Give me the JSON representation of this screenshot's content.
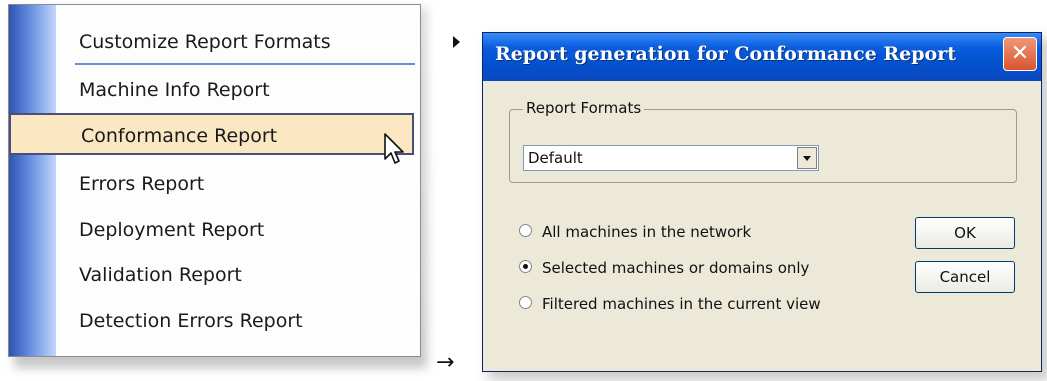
{
  "menu": {
    "items": [
      {
        "label": "Customize Report Formats"
      },
      {
        "label": "Machine Info Report"
      },
      {
        "label": "Conformance Report"
      },
      {
        "label": "Errors Report"
      },
      {
        "label": "Deployment Report"
      },
      {
        "label": "Validation Report"
      },
      {
        "label": "Detection Errors Report"
      }
    ],
    "selected_item": "Conformance Report"
  },
  "flow_arrow": "→",
  "dialog": {
    "title": "Report generation for  Conformance Report",
    "close_glyph": "✕",
    "report_formats": {
      "legend": "Report Formats",
      "selected_value": "Default"
    },
    "options": [
      {
        "label": "All machines in the network",
        "checked": false
      },
      {
        "label": "Selected machines or domains only",
        "checked": true
      },
      {
        "label": "Filtered machines in the current view",
        "checked": false
      }
    ],
    "buttons": {
      "ok_label": "OK",
      "cancel_label": "Cancel"
    }
  }
}
